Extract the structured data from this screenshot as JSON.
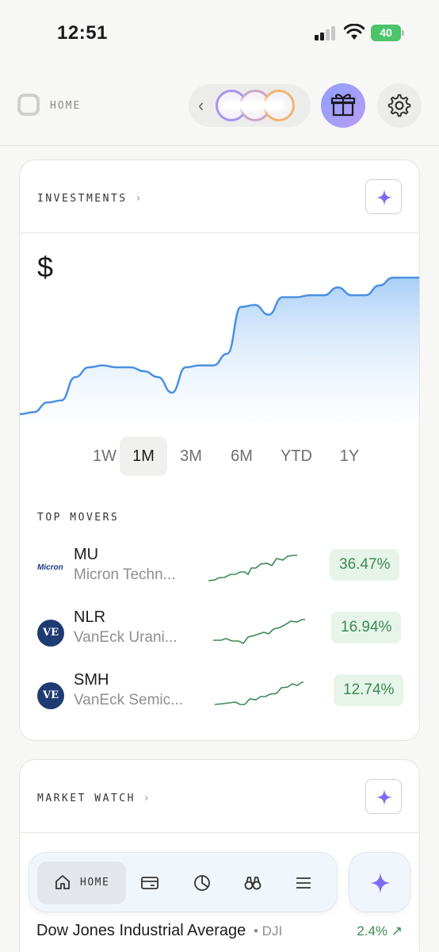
{
  "status_bar": {
    "time": "12:51",
    "battery": "40"
  },
  "header": {
    "home_label": "HOME"
  },
  "investments": {
    "title": "INVESTMENTS",
    "arrow": "›",
    "balance_symbol": "$",
    "ranges": [
      "1W",
      "1M",
      "3M",
      "6M",
      "YTD",
      "1Y"
    ],
    "active_range": "1M",
    "chart_data": {
      "type": "area",
      "values": [
        10,
        12,
        22,
        24,
        48,
        58,
        60,
        58,
        58,
        54,
        48,
        32,
        58,
        60,
        60,
        72,
        120,
        122,
        112,
        130,
        130,
        132,
        132,
        140,
        132,
        132,
        142,
        150,
        150,
        150
      ],
      "color": "#4a90e2"
    },
    "movers_title": "TOP MOVERS",
    "movers": [
      {
        "symbol": "MU",
        "name": "Micron Techn...",
        "change": "36.47%",
        "logo": "Micron"
      },
      {
        "symbol": "NLR",
        "name": "VanEck Urani...",
        "change": "16.94%",
        "logo": "VE"
      },
      {
        "symbol": "SMH",
        "name": "VanEck Semic...",
        "change": "12.74%",
        "logo": "VE"
      }
    ],
    "sparkline_color": "#3a8a55"
  },
  "market_watch": {
    "title": "MARKET WATCH",
    "arrow": "›",
    "rows": [
      {
        "name": "Dow Jones Industrial Average",
        "symbol": "• DJI",
        "change": "2.4% ↗"
      }
    ]
  },
  "bottom_nav": {
    "home_label": "HOME",
    "items": [
      "home-icon",
      "card-icon",
      "pie-chart-icon",
      "binoculars-icon",
      "menu-icon"
    ]
  },
  "colors": {
    "accent": "#7b6cf0",
    "positive": "#3a8a55",
    "chart_line": "#4a90e2"
  }
}
